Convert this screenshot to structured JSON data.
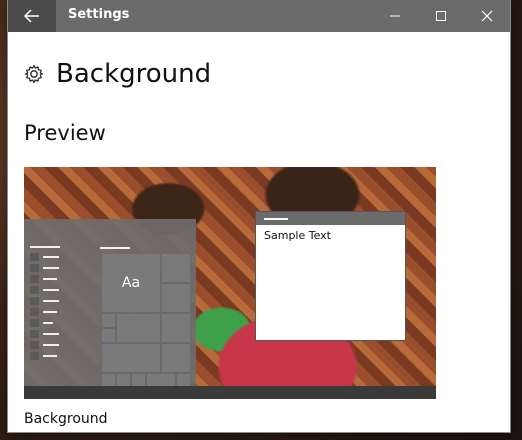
{
  "titlebar": {
    "app_title": "Settings",
    "back_icon": "arrow-left-icon",
    "minimize_icon": "minimize-icon",
    "maximize_icon": "maximize-icon",
    "close_icon": "close-icon"
  },
  "header": {
    "icon": "gear-icon",
    "title": "Background"
  },
  "preview": {
    "section_title": "Preview",
    "start_tile_label": "Aa",
    "sample_text": "Sample Text"
  },
  "settings": {
    "background_label": "Background"
  },
  "colors": {
    "titlebar": "#6b6b6b",
    "back_button": "#4a4a4a",
    "window_bg": "#ffffff",
    "start_menu": "#6e6e6e"
  }
}
